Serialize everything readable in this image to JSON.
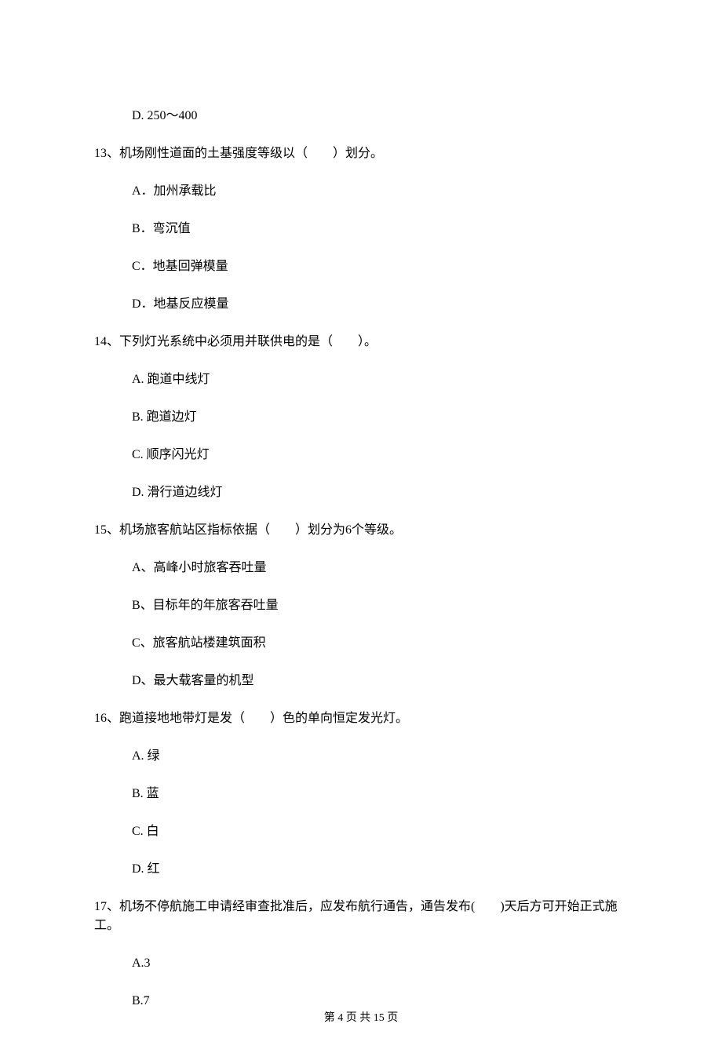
{
  "prev_option_d": "D. 250～400",
  "q13": {
    "stem": "13、机场刚性道面的土基强度等级以（　　）划分。",
    "a": "A．加州承载比",
    "b": "B．弯沉值",
    "c": "C．地基回弹模量",
    "d": "D．地基反应模量"
  },
  "q14": {
    "stem": "14、下列灯光系统中必须用并联供电的是（　　）。",
    "a": "A. 跑道中线灯",
    "b": "B. 跑道边灯",
    "c": "C. 顺序闪光灯",
    "d": "D. 滑行道边线灯"
  },
  "q15": {
    "stem": "15、机场旅客航站区指标依据（　　）划分为6个等级。",
    "a": "A、高峰小时旅客吞吐量",
    "b": "B、目标年的年旅客吞吐量",
    "c": "C、旅客航站楼建筑面积",
    "d": "D、最大载客量的机型"
  },
  "q16": {
    "stem": "16、跑道接地地带灯是发（　　）色的单向恒定发光灯。",
    "a": "A. 绿",
    "b": "B. 蓝",
    "c": "C. 白",
    "d": "D. 红"
  },
  "q17": {
    "stem": "17、机场不停航施工申请经审查批准后，应发布航行通告，通告发布(　　)天后方可开始正式施工。",
    "a": "A.3",
    "b": "B.7"
  },
  "footer": "第 4 页 共 15 页"
}
